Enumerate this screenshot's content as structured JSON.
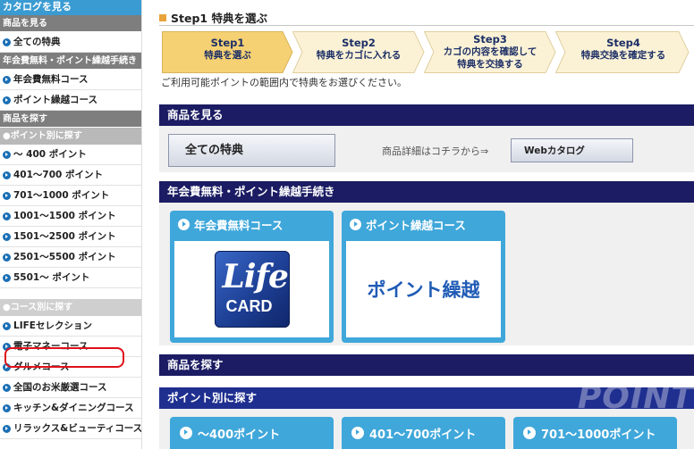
{
  "sidebar": {
    "top": "カタログを見る",
    "view_header": "商品を見る",
    "all_items": "全ての特典",
    "annual_header": "年会費無料・ポイント繰越手続き",
    "annual_course": "年会費無料コース",
    "carryover_course": "ポイント繰越コース",
    "search_header": "商品を探す",
    "by_point_header": "●ポイント別に探す",
    "point_items": [
      "～ 400 ポイント",
      "401～700 ポイント",
      "701～1000 ポイント",
      "1001～1500 ポイント",
      "1501～2500 ポイント",
      "2501～5500 ポイント",
      "5501～ ポイント"
    ],
    "by_course_header": "●コース別に探す",
    "course_items": [
      "LIFEセレクション",
      "電子マネーコース",
      "グルメコース",
      "全国のお米厳選コース",
      "キッチン&ダイニングコース",
      "リラックス&ビューティコース"
    ]
  },
  "main": {
    "title": "Step1  特典を選ぶ",
    "steps": [
      {
        "num": "Step1",
        "label": "特典を選ぶ"
      },
      {
        "num": "Step2",
        "label": "特典をカゴに入れる"
      },
      {
        "num": "Step3",
        "label1": "カゴの内容を確認して",
        "label2": "特典を交換する"
      },
      {
        "num": "Step4",
        "label": "特典交換を確定する"
      }
    ],
    "note": "ご利用可能ポイントの範囲内で特典をお選びください。",
    "view_band": "商品を見る",
    "all_button": "全ての特典",
    "detail_text": "商品詳細はコチラから⇒",
    "web_catalog_button": "Webカタログ",
    "annual_band": "年会費無料・ポイント繰越手続き",
    "annual_card": "年会費無料コース",
    "carryover_card": "ポイント繰越コース",
    "life_logo_top": "Life",
    "life_logo_bottom": "CARD",
    "carryover_image_text": "ポイント繰越",
    "search_band": "商品を探す",
    "by_point_band": "ポイント別に探す",
    "watermark": "POINT",
    "point_buttons": [
      "～400ポイント",
      "401～700ポイント",
      "701～1000ポイント"
    ]
  },
  "colors": {
    "sidebar_top": "#3a9bd2",
    "band_navy": "#1b1c63",
    "card_blue": "#3fa7da",
    "step_active": "#f5d173",
    "step_inactive": "#fbf2d6",
    "highlight_red": "#e0101a"
  }
}
